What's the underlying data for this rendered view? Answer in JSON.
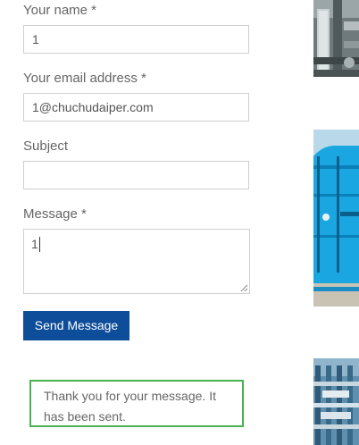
{
  "form": {
    "name": {
      "label": "Your name *",
      "value": "1"
    },
    "email": {
      "label": "Your email address *",
      "value": "1@chuchudaiper.com"
    },
    "subject": {
      "label": "Subject",
      "value": ""
    },
    "message": {
      "label": "Message *",
      "value": "1"
    },
    "submit_label": "Send Message",
    "success_message": "Thank you for your message. It has been sent."
  },
  "colors": {
    "button_bg": "#0d4d9a",
    "success_border": "#46b450",
    "field_border": "#cfcfcf"
  },
  "sidebar_images": [
    {
      "alt": "industrial pipes machinery"
    },
    {
      "alt": "blue water treatment tank"
    },
    {
      "alt": "industrial piping equipment"
    }
  ]
}
